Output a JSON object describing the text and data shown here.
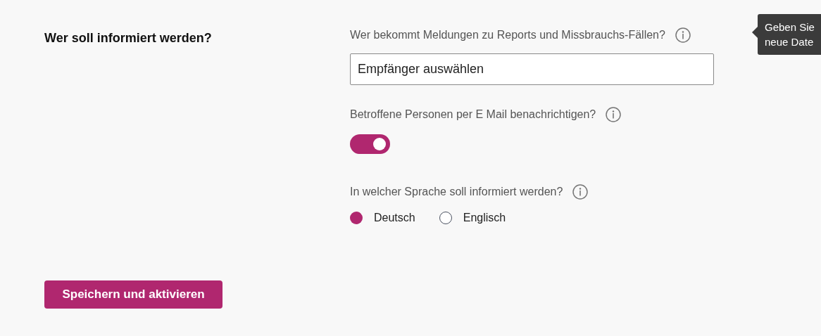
{
  "section": {
    "title": "Wer soll informiert werden?"
  },
  "recipients": {
    "label": "Wer bekommt Meldungen zu Reports und Missbrauchs-Fällen?",
    "value": "Empfänger auswählen"
  },
  "notify": {
    "label": "Betroffene Personen per E Mail benachrichtigen?",
    "on": true
  },
  "language": {
    "label": "In welcher Sprache soll informiert werden?",
    "options": [
      {
        "label": "Deutsch",
        "selected": true
      },
      {
        "label": "Englisch",
        "selected": false
      }
    ]
  },
  "tooltip": {
    "lines": [
      "Geben Sie",
      "neue Date"
    ]
  },
  "save_button": "Speichern und aktivieren"
}
